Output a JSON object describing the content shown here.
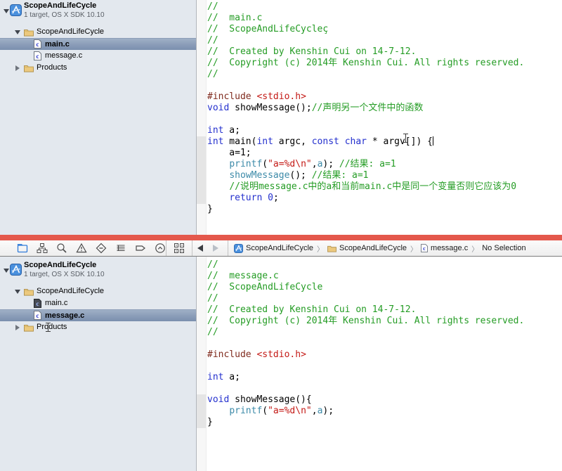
{
  "colors": {
    "accent_red_divider": "#E4584C",
    "navigator_bg": "#E3E8EE",
    "selection_top": "#9FB0C6",
    "selection_bottom": "#7A8FAE",
    "comment": "#249C24",
    "keyword": "#2430CE",
    "preprocessor": "#7F2A1D",
    "string": "#C41A16",
    "function_call": "#3C8AA8",
    "variable": "#3C8AA8",
    "number": "#2430CE",
    "plain": "#000000"
  },
  "navigators": {
    "top": {
      "project_name": "ScopeAndLifeCycle",
      "project_subtitle": "1 target, OS X SDK 10.10",
      "group_name": "ScopeAndLifeCycle",
      "file1": "main.c",
      "file2": "message.c",
      "products_label": "Products",
      "selected_file": "main.c"
    },
    "bottom": {
      "project_name": "ScopeAndLifeCycle",
      "project_subtitle": "1 target, OS X SDK 10.10",
      "group_name": "ScopeAndLifeCycle",
      "file1": "main.c",
      "file2": "message.c",
      "products_label": "Products",
      "selected_file": "message.c"
    }
  },
  "toolbar": {
    "navigator_icons": [
      "project-navigator",
      "symbol-navigator",
      "find-navigator",
      "issue-navigator",
      "test-navigator",
      "debug-navigator",
      "breakpoint-navigator",
      "log-navigator"
    ],
    "jump_icons": [
      "related-items",
      "back-arrow",
      "forward-arrow"
    ],
    "breadcrumb": {
      "project": "ScopeAndLifeCycle",
      "group": "ScopeAndLifeCycle",
      "file": "message.c",
      "selection": "No Selection"
    }
  },
  "editors": {
    "top": {
      "file": "main.c",
      "caret_line": 12,
      "lines": [
        [
          [
            "//",
            "cm"
          ]
        ],
        [
          [
            "//  main.c",
            "cm"
          ]
        ],
        [
          [
            "//  ScopeAndLifeCycleç",
            "cm"
          ]
        ],
        [
          [
            "//",
            "cm"
          ]
        ],
        [
          [
            "//  Created by Kenshin Cui on 14-7-12.",
            "cm"
          ]
        ],
        [
          [
            "//  Copyright (c) 2014年 Kenshin Cui. All rights reserved.",
            "cm"
          ]
        ],
        [
          [
            "//",
            "cm"
          ]
        ],
        [],
        [
          [
            "#include",
            "pp"
          ],
          [
            " ",
            "pl"
          ],
          [
            "<stdio.h>",
            "str"
          ]
        ],
        [
          [
            "void",
            "kw"
          ],
          [
            " showMessage();",
            "pl"
          ],
          [
            "//声明另一个文件中的函数",
            "cm"
          ]
        ],
        [],
        [
          [
            "int",
            "kw"
          ],
          [
            " a;",
            "pl"
          ]
        ],
        [
          [
            "int",
            "kw"
          ],
          [
            " main(",
            "pl"
          ],
          [
            "int",
            "kw"
          ],
          [
            " argc, ",
            "pl"
          ],
          [
            "const",
            "kw"
          ],
          [
            " ",
            "pl"
          ],
          [
            "char",
            "kw"
          ],
          [
            " * argv[]) {",
            "pl"
          ]
        ],
        [
          [
            "    a=1;",
            "pl"
          ]
        ],
        [
          [
            "    ",
            "pl"
          ],
          [
            "printf",
            "fn"
          ],
          [
            "(",
            "pl"
          ],
          [
            "\"a=%d\\n\"",
            "str"
          ],
          [
            ",",
            "pl"
          ],
          [
            "a",
            "var"
          ],
          [
            "); ",
            "pl"
          ],
          [
            "//结果: a=1",
            "cm"
          ]
        ],
        [
          [
            "    ",
            "pl"
          ],
          [
            "showMessage",
            "fn"
          ],
          [
            "(); ",
            "pl"
          ],
          [
            "//结果: a=1",
            "cm"
          ]
        ],
        [
          [
            "    ",
            "pl"
          ],
          [
            "//说明message.c中的a和当前main.c中是同一个变量否则它应该为0",
            "cm"
          ]
        ],
        [
          [
            "    ",
            "pl"
          ],
          [
            "return",
            "kw"
          ],
          [
            " ",
            "pl"
          ],
          [
            "0",
            "num"
          ],
          [
            ";",
            "pl"
          ]
        ],
        [
          [
            "}",
            "pl"
          ]
        ]
      ]
    },
    "bottom": {
      "file": "message.c",
      "caret_line": -1,
      "lines": [
        [
          [
            "//",
            "cm"
          ]
        ],
        [
          [
            "//  message.c",
            "cm"
          ]
        ],
        [
          [
            "//  ScopeAndLifeCycle",
            "cm"
          ]
        ],
        [
          [
            "//",
            "cm"
          ]
        ],
        [
          [
            "//  Created by Kenshin Cui on 14-7-12.",
            "cm"
          ]
        ],
        [
          [
            "//  Copyright (c) 2014年 Kenshin Cui. All rights reserved.",
            "cm"
          ]
        ],
        [
          [
            "//",
            "cm"
          ]
        ],
        [],
        [
          [
            "#include",
            "pp"
          ],
          [
            " ",
            "pl"
          ],
          [
            "<stdio.h>",
            "str"
          ]
        ],
        [],
        [
          [
            "int",
            "kw"
          ],
          [
            " a;",
            "pl"
          ]
        ],
        [],
        [
          [
            "void",
            "kw"
          ],
          [
            " showMessage(){",
            "pl"
          ]
        ],
        [
          [
            "    ",
            "pl"
          ],
          [
            "printf",
            "fn"
          ],
          [
            "(",
            "pl"
          ],
          [
            "\"a=%d\\n\"",
            "str"
          ],
          [
            ",",
            "pl"
          ],
          [
            "a",
            "var"
          ],
          [
            ");",
            "pl"
          ]
        ],
        [
          [
            "}",
            "pl"
          ]
        ]
      ]
    }
  }
}
